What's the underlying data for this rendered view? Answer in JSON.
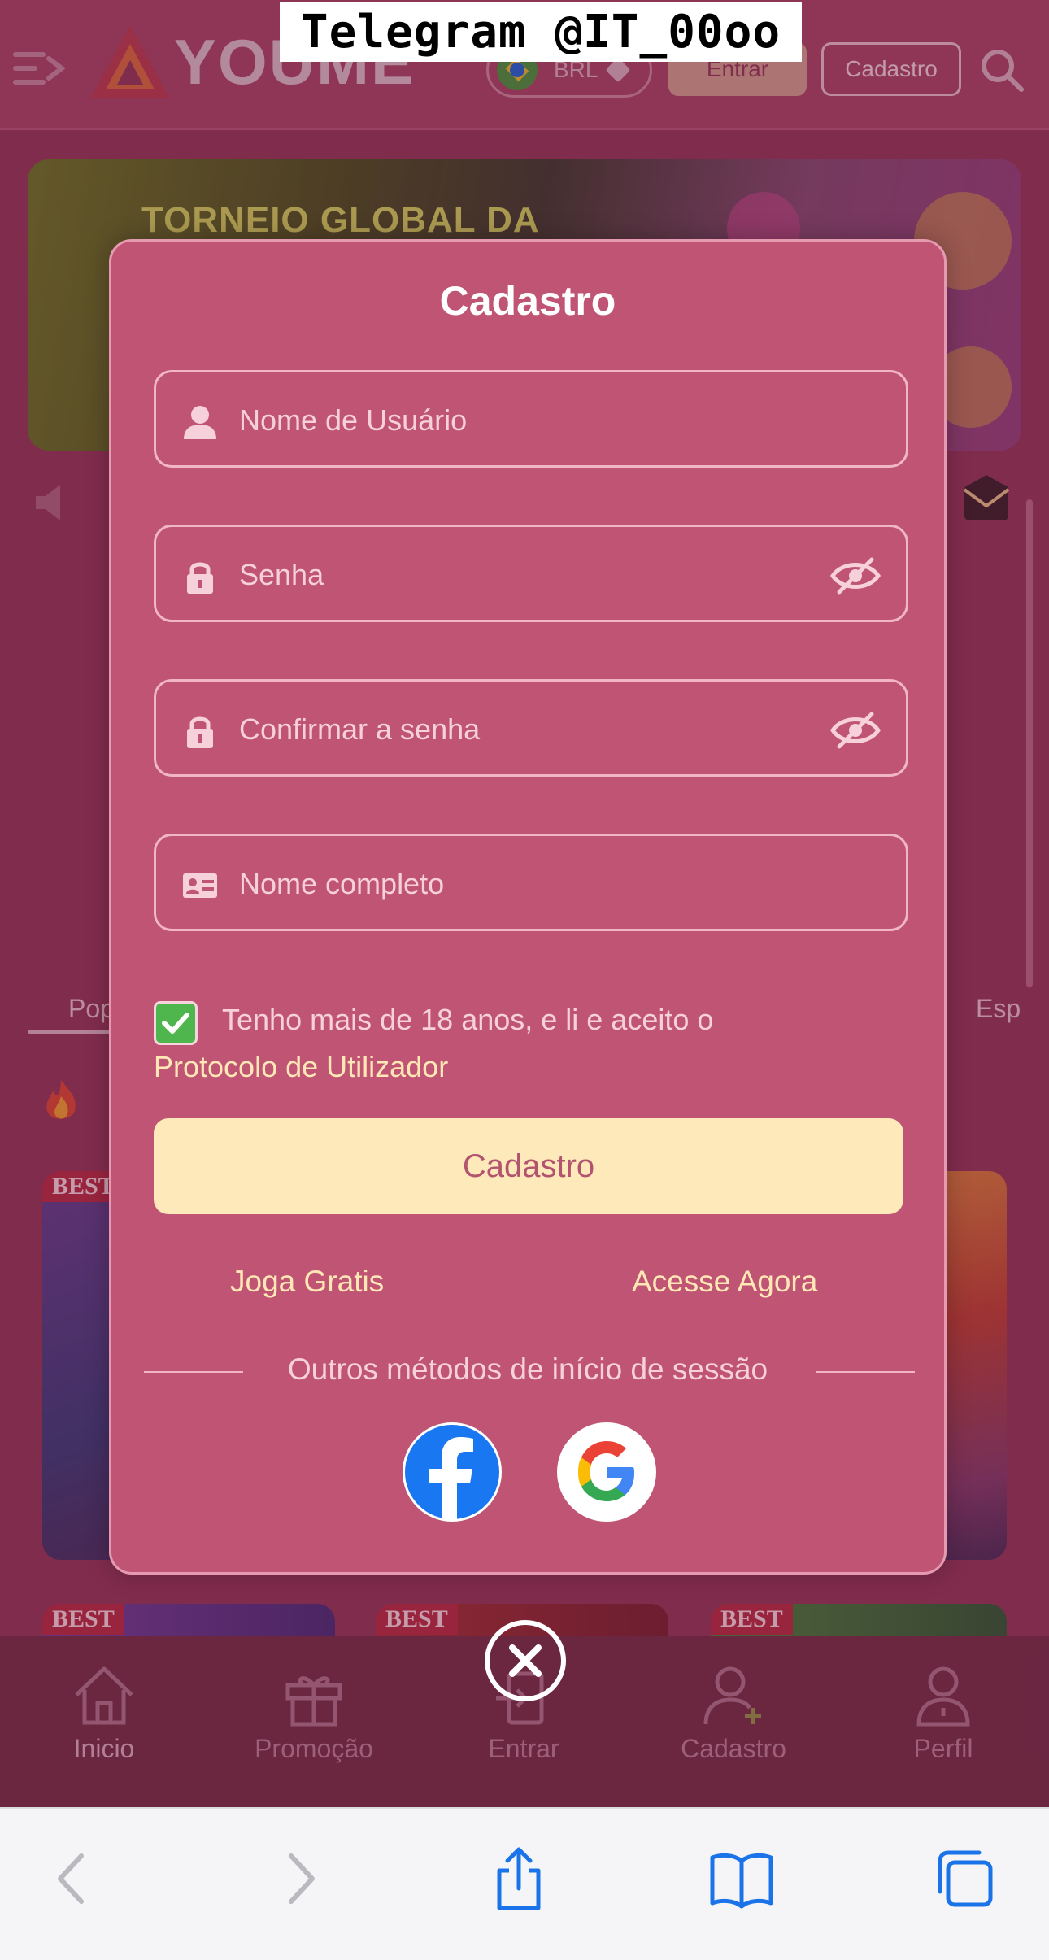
{
  "watermark": "Telegram @IT_00oo",
  "header": {
    "logo_text": "YOUME",
    "currency": "BRL",
    "login_label": "Entrar",
    "register_label": "Cadastro"
  },
  "banner": {
    "title": "TORNEIO GLOBAL DA"
  },
  "categories": {
    "left_label": "Pop",
    "right_label": "Esp"
  },
  "game_badge": "BEST",
  "modal": {
    "title": "Cadastro",
    "fields": {
      "username_placeholder": "Nome de Usuário",
      "password_placeholder": "Senha",
      "confirm_placeholder": "Confirmar a senha",
      "fullname_placeholder": "Nome completo"
    },
    "terms_text": "Tenho mais de 18 anos, e li e aceito o",
    "terms_link": "Protocolo de Utilizador",
    "terms_checked": true,
    "submit_label": "Cadastro",
    "free_play_label": "Joga Gratis",
    "access_now_label": "Acesse Agora",
    "other_methods_label": "Outros métodos de início de sessão",
    "social": [
      "facebook-icon",
      "google-icon"
    ]
  },
  "bottom_nav": {
    "items": [
      {
        "label": "Inicio",
        "icon": "home-icon"
      },
      {
        "label": "Promoção",
        "icon": "gift-icon"
      },
      {
        "label": "Entrar",
        "icon": "login-icon"
      },
      {
        "label": "Cadastro",
        "icon": "add-user-icon"
      },
      {
        "label": "Perfil",
        "icon": "profile-icon"
      }
    ]
  },
  "colors": {
    "modal_bg": "#c05474",
    "submit_bg": "#fee9bb",
    "link": "#ffe8b6",
    "checkbox": "#4fb64d",
    "browser_accent": "#1a73e8"
  }
}
